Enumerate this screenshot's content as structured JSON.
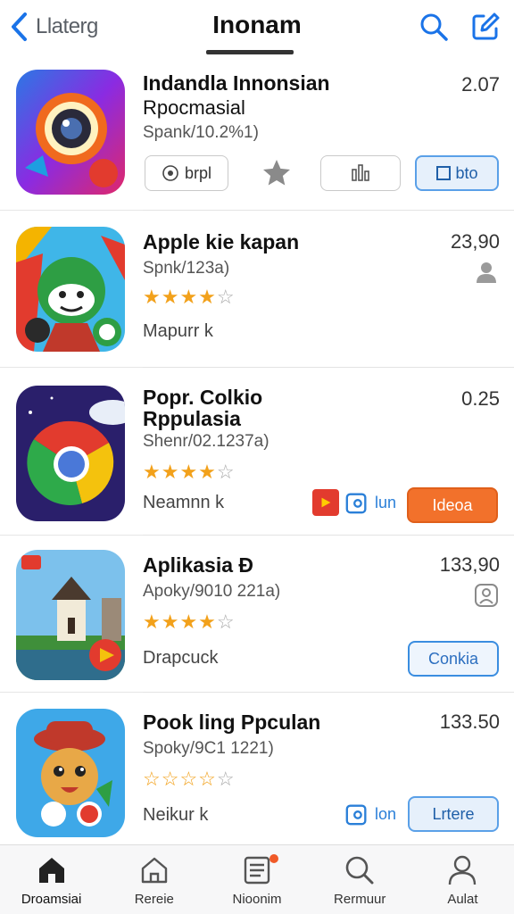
{
  "header": {
    "back_label": "Llaterg",
    "title": "Inonam"
  },
  "apps": [
    {
      "name": "Indandla Innonsian",
      "name2": "Rpocmasial",
      "sub": "Spank/10.2%1)",
      "price": "2.07",
      "buttons": {
        "b1": "brpl",
        "b4": "bto"
      }
    },
    {
      "name": "Apple kie kapan",
      "sub": "Spnk/123a)",
      "price": "23,90",
      "meta": "Mapurr k"
    },
    {
      "name": "Popr. Colkio",
      "name2": "Rppulasia",
      "sub": "Shenr/02.1237a)",
      "price": "0.25",
      "meta": "Neamnn k",
      "buttons": {
        "small": "lun",
        "big": "Ideoa"
      }
    },
    {
      "name": "Aplikasia Ð",
      "sub": "Apoky/9010 221a)",
      "price": "133,90",
      "meta": "Drapcuck",
      "buttons": {
        "big": "Conkia"
      }
    },
    {
      "name": "Pook ling Ppculan",
      "sub": "Spoky/9C1 1221)",
      "price": "133.50",
      "meta": "Neikur k",
      "buttons": {
        "small": "lon",
        "big": "Lrtere"
      }
    }
  ],
  "tabs": [
    {
      "label": "Droamsiai",
      "icon": "home-icon"
    },
    {
      "label": "Rereie",
      "icon": "house-outline-icon"
    },
    {
      "label": "Nioonim",
      "icon": "list-icon"
    },
    {
      "label": "Rermuur",
      "icon": "search-icon"
    },
    {
      "label": "Aulat",
      "icon": "person-icon"
    }
  ],
  "colors": {
    "accent": "#1a73e8",
    "star": "#f2a11b",
    "orange": "#f2712b"
  }
}
